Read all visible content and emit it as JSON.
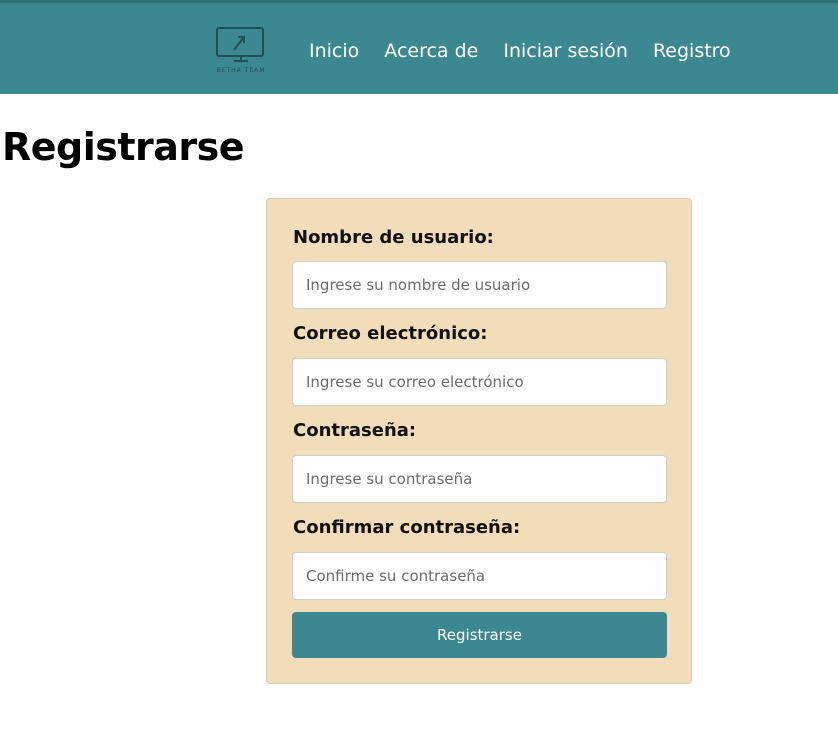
{
  "nav": {
    "logo_text": "BETHA TEAM",
    "links": [
      {
        "label": "Inicio"
      },
      {
        "label": "Acerca de"
      },
      {
        "label": "Iniciar sesión"
      },
      {
        "label": "Registro"
      }
    ]
  },
  "page": {
    "title": "Registrarse"
  },
  "form": {
    "username": {
      "label": "Nombre de usuario:",
      "placeholder": "Ingrese su nombre de usuario"
    },
    "email": {
      "label": "Correo electrónico:",
      "placeholder": "Ingrese su correo electrónico"
    },
    "password": {
      "label": "Contraseña:",
      "placeholder": "Ingrese su contraseña"
    },
    "confirm": {
      "label": "Confirmar contraseña:",
      "placeholder": "Confirme su contraseña"
    },
    "submit_label": "Registrarse"
  },
  "colors": {
    "navbar": "#3b8890",
    "card": "#f2ddbb",
    "button": "#3b8890"
  }
}
